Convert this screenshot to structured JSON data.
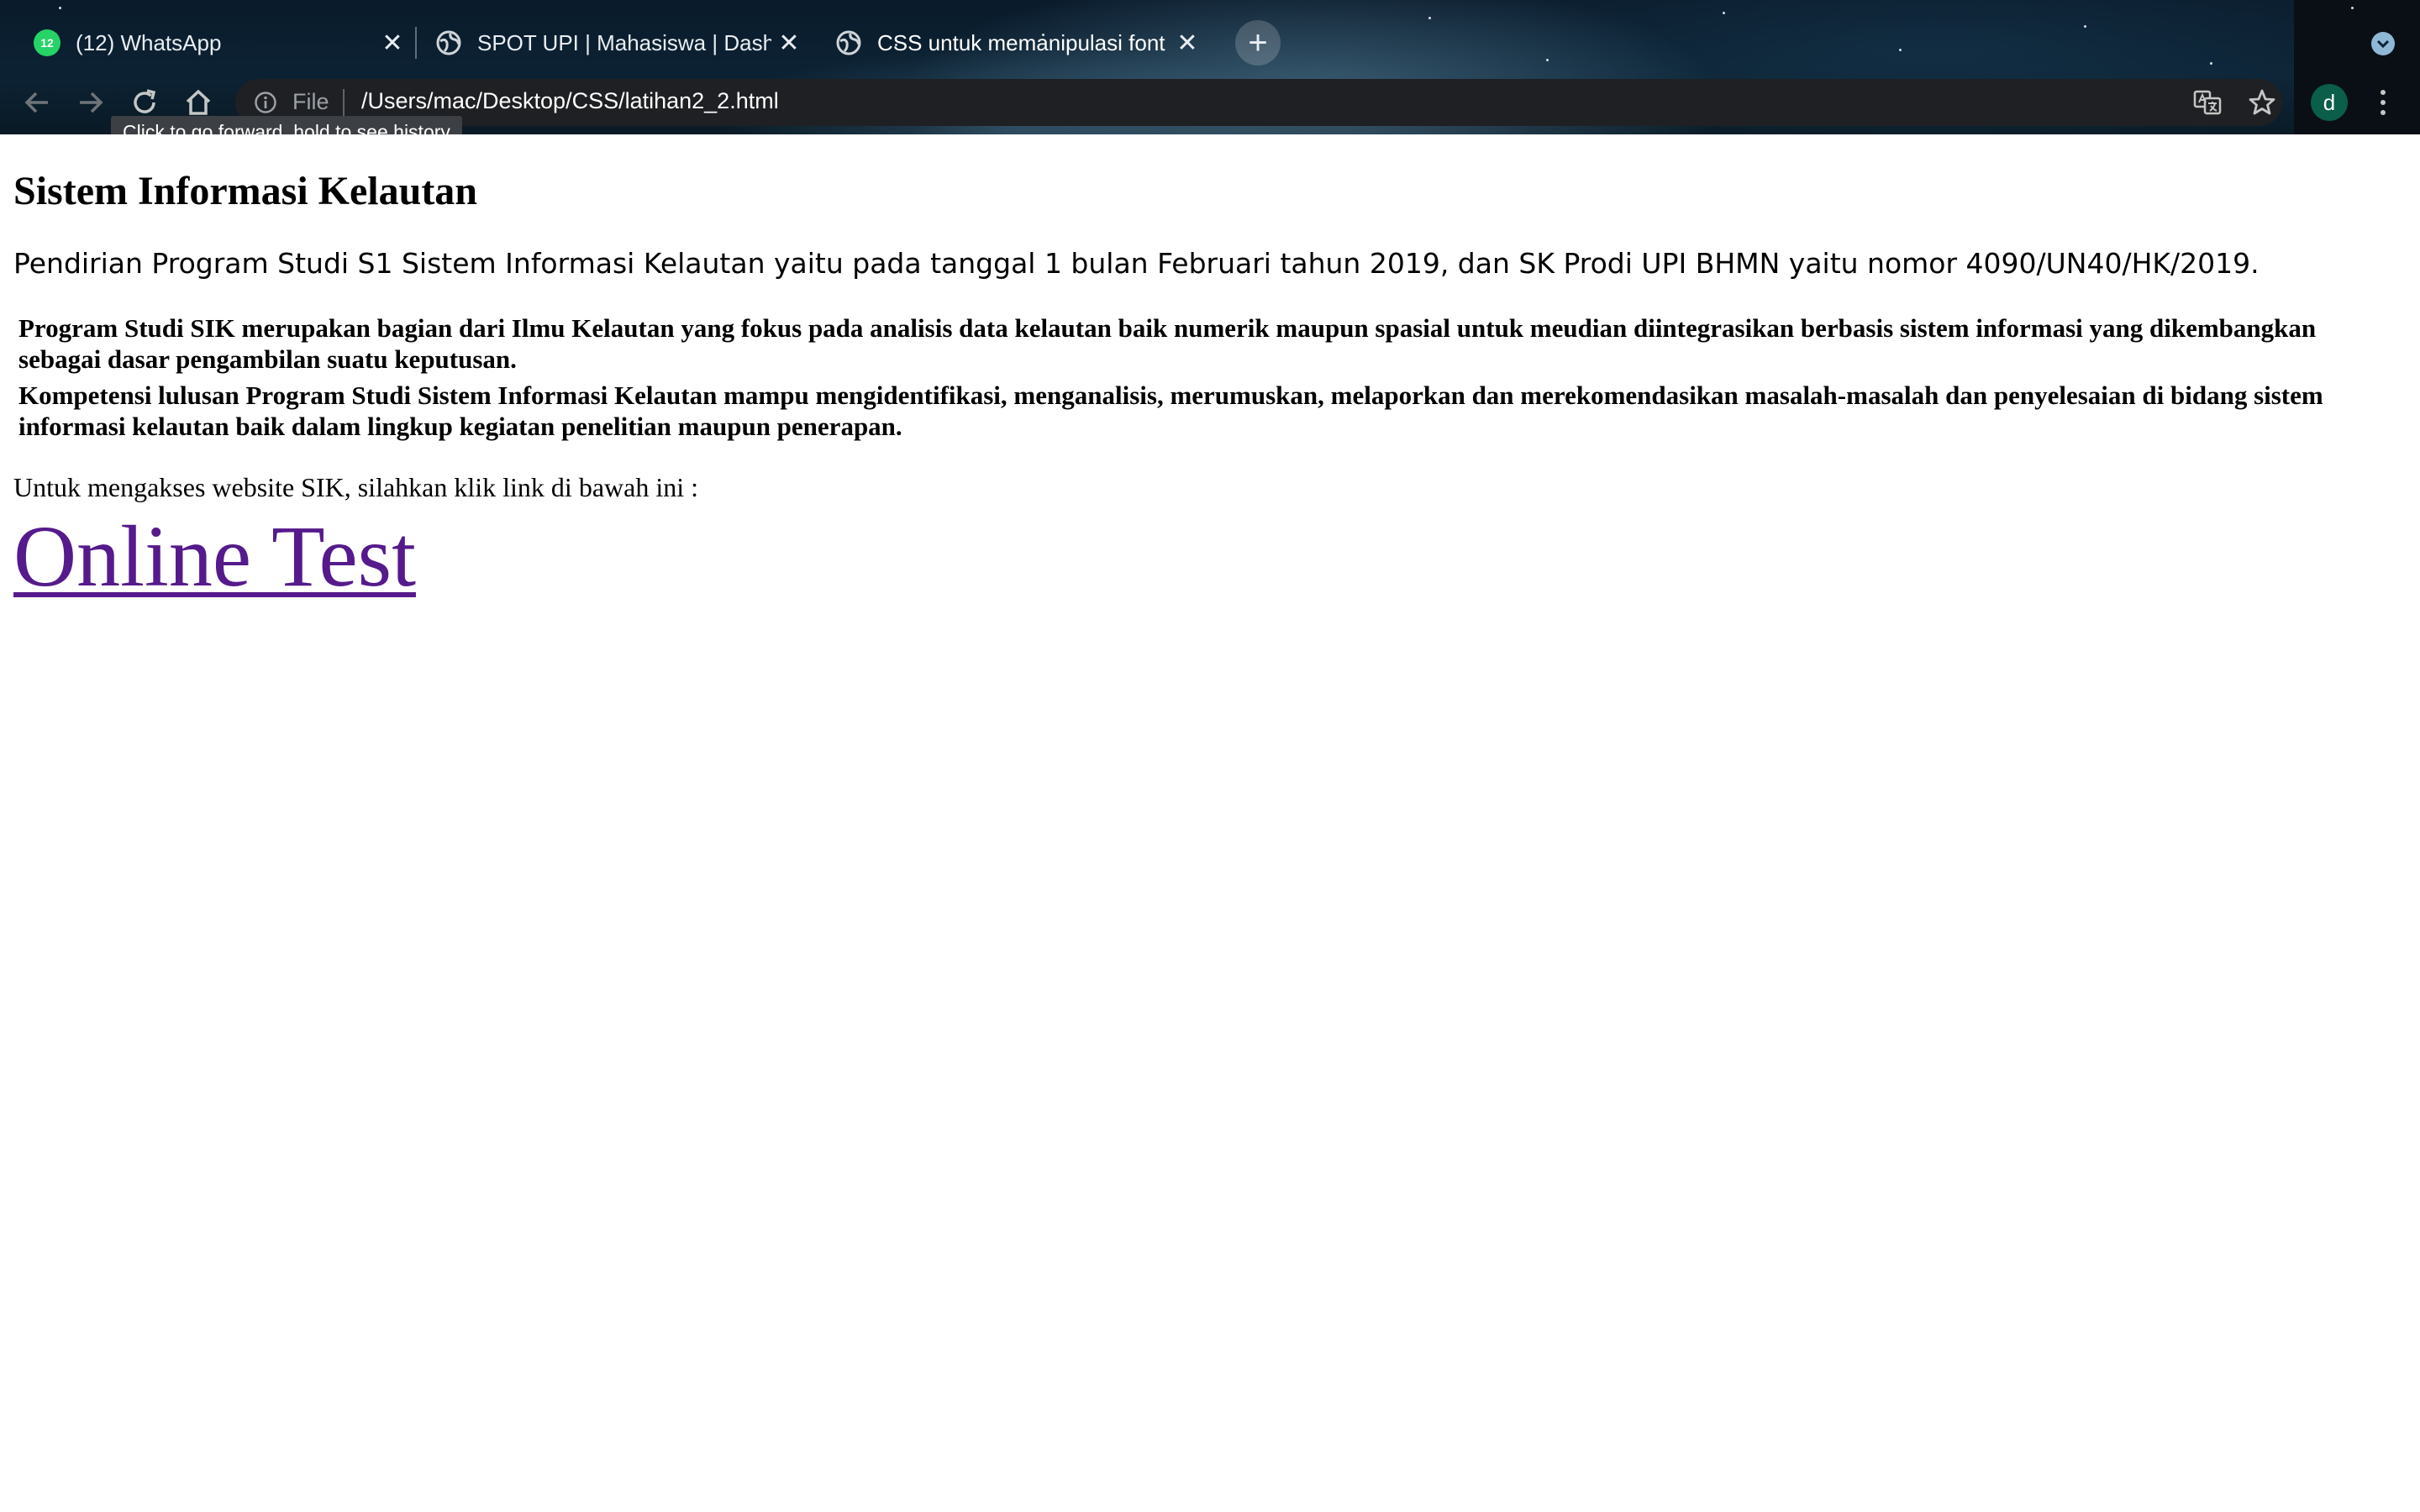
{
  "browser": {
    "tabs": [
      {
        "title": "(12) WhatsApp",
        "badge": "12",
        "icon": "whatsapp-icon"
      },
      {
        "title": "SPOT UPI | Mahasiswa | Dashb",
        "icon": "globe-icon"
      },
      {
        "title": "CSS untuk memanipulasi font",
        "icon": "globe-icon",
        "active": true
      }
    ],
    "new_tab_label": "+",
    "address_bar": {
      "scheme_label": "File",
      "url": "/Users/mac/Desktop/CSS/latihan2_2.html"
    },
    "profile_initial": "d",
    "tooltip": "Click to go forward, hold to see history"
  },
  "page": {
    "heading": "Sistem Informasi Kelautan",
    "intro": "Pendirian Program Studi S1 Sistem Informasi Kelautan yaitu pada tanggal 1 bulan Februari tahun 2019, dan SK Prodi UPI BHMN yaitu nomor 4090/UN40/HK/2019.",
    "paragraph1": "Program Studi SIK merupakan bagian dari Ilmu Kelautan yang fokus pada analisis data kelautan baik numerik maupun spasial untuk meudian diintegrasikan berbasis sistem informasi yang dikembangkan sebagai dasar pengambilan suatu keputusan.",
    "paragraph2": "Kompetensi lulusan Program Studi Sistem Informasi Kelautan mampu mengidentifikasi, menganalisis, merumuskan, melaporkan dan merekomendasikan masalah-masalah dan penyelesaian di bidang sistem informasi kelautan baik dalam lingkup kegiatan penelitian maupun penerapan.",
    "access_text": "Untuk mengakses website SIK, silahkan klik link di bawah ini :",
    "link_text": "Online Test"
  },
  "colors": {
    "link_visited": "#551a8b",
    "omnibox_bg": "#1f2023",
    "avatar_bg": "#0b5e49",
    "whatsapp_green": "#25d366"
  }
}
